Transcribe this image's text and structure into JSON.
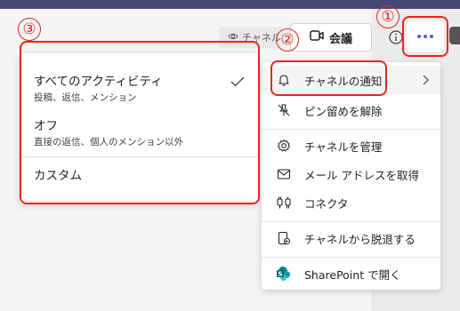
{
  "header": {
    "channel_label": "チャネル",
    "meet_label": "会議"
  },
  "callouts": [
    "①",
    "②",
    "③"
  ],
  "menu": {
    "items": [
      {
        "label": "チャネルの通知",
        "icon": "bell-icon",
        "has_submenu": true
      },
      {
        "label": "ピン留めを解除",
        "icon": "unpin-icon"
      },
      {
        "label": "チャネルを管理",
        "icon": "gear-icon"
      },
      {
        "label": "メール アドレスを取得",
        "icon": "mail-icon"
      },
      {
        "label": "コネクタ",
        "icon": "connector-icon"
      },
      {
        "label": "チャネルから脱退する",
        "icon": "leave-icon"
      },
      {
        "label": "SharePoint で開く",
        "icon": "sharepoint-icon"
      }
    ]
  },
  "submenu": {
    "options": [
      {
        "title": "すべてのアクティビティ",
        "description": "投稿、返信、メンション",
        "selected": true
      },
      {
        "title": "オフ",
        "description": "直接の返信、個人のメンション以外",
        "selected": false
      },
      {
        "title": "カスタム",
        "description": "",
        "selected": false
      }
    ]
  },
  "colors": {
    "accent": "#5b5fc7",
    "callout": "#e8251f",
    "topbar": "#464775",
    "sharepoint": "#036c70"
  }
}
